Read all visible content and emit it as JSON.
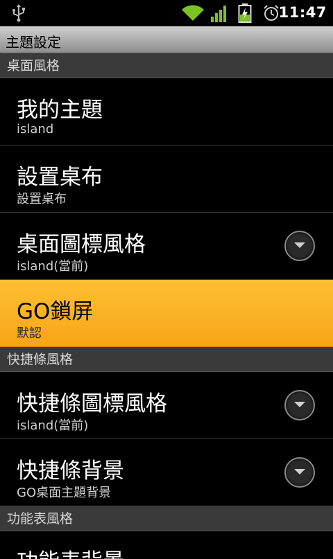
{
  "status_bar": {
    "time": "11:47",
    "icons": [
      "usb-icon",
      "wifi-icon",
      "signal-icon",
      "battery-charging-icon",
      "alarm-icon"
    ],
    "accent_color": "#7bc420"
  },
  "title_bar": {
    "title": "主題設定"
  },
  "sections": [
    {
      "header": "桌面風格",
      "items": [
        {
          "title": "我的主題",
          "summary": "island"
        },
        {
          "title": "設置桌布",
          "summary": "設置桌布"
        },
        {
          "title": "桌面圖標風格",
          "summary": "island(當前)",
          "has_dropdown": true
        },
        {
          "title": "GO鎖屏",
          "summary": "默認",
          "highlighted": true
        }
      ]
    },
    {
      "header": "快捷條風格",
      "items": [
        {
          "title": "快捷條圖標風格",
          "summary": "island(當前)",
          "has_dropdown": true
        },
        {
          "title": "快捷條背景",
          "summary": "GO桌面主題背景",
          "has_dropdown": true
        }
      ]
    },
    {
      "header": "功能表風格",
      "items": [
        {
          "title": "功能表背景"
        }
      ]
    }
  ],
  "colors": {
    "highlight": "#f9ad1f",
    "section_header_bg": "#3a3a3a",
    "title_bar_bg": "#b0b0b0"
  }
}
